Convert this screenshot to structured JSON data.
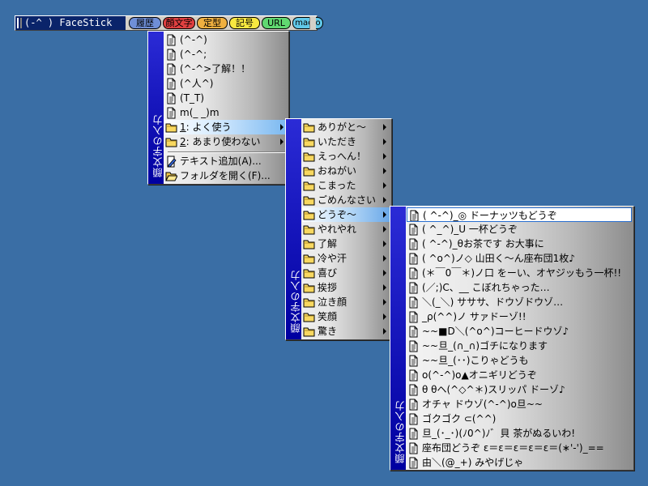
{
  "toolbar": {
    "title": "(-^ ) FaceStick",
    "buttons": [
      {
        "label": "履歴",
        "bg": "#6f8fd8"
      },
      {
        "label": "顔文字",
        "bg": "#e04040"
      },
      {
        "label": "定型",
        "bg": "#f0b040"
      },
      {
        "label": "記号",
        "bg": "#f8e840"
      },
      {
        "label": "URL",
        "bg": "#60d870"
      },
      {
        "label": "macro",
        "bg": "#60c8e8"
      }
    ]
  },
  "menu1": {
    "strip": "顔文字の入力",
    "items": [
      "(^-^)",
      "(^-^;",
      "(^-^>了解！！",
      "(^人^)",
      "(T_T)",
      "m(_ _)m"
    ],
    "folders": [
      {
        "key": "1",
        "label": ": よく使う"
      },
      {
        "key": "2",
        "label": ": あまり使わない"
      }
    ],
    "actions": [
      "テキスト追加(A)...",
      "フォルダを開く(F)..."
    ]
  },
  "menu2": {
    "strip": "顔文字の入力",
    "folders": [
      "ありがと〜",
      "いただき",
      "えっへん！",
      "おねがい",
      "こまった",
      "ごめんなさい",
      "どうぞ〜",
      "やれやれ",
      "了解",
      "冷や汗",
      "喜び",
      "挨拶",
      "泣き顔",
      "笑顔",
      "驚き"
    ]
  },
  "menu3": {
    "strip": "顔文字の入力",
    "items": [
      "( ^-^)_◎ ドーナッツもどうぞ",
      "( ^_^)_U 一杯どうぞ",
      "( ^-^)_θお茶です お大事に",
      "( ^o^)ノ◇ 山田く〜ん座布団1枚♪",
      "(＊￣0￣＊)ノ口 をーい、オヤジッもう一杯!!",
      "(／;)C、__ こぼれちゃった…",
      "＼(_＼) サササ、ドウゾドウゾ…",
      "_ρ(^^)ノ サァドーゾ!!",
      "~~■D＼(^o^)コーヒードウゾ♪",
      "~~旦_(∩_∩)ゴチになります",
      "~~旦_(･･)こりゃどうも",
      "o(^-^)o▲オニギリどうぞ",
      "θ θヘ(^◇^＊)スリッパ ドーゾ♪",
      "オチャ ドウゾ(^-^)o旦~~",
      "ゴクゴク ⊂(^^)",
      "旦_(･_･)(ﾉ0^)ﾉ゛貝 茶がぬるいわ!",
      "座布団どうぞ ε＝ε＝ε＝ε＝ε＝(∗'-')_==",
      "由＼(@_+) みやげじゃ"
    ]
  }
}
